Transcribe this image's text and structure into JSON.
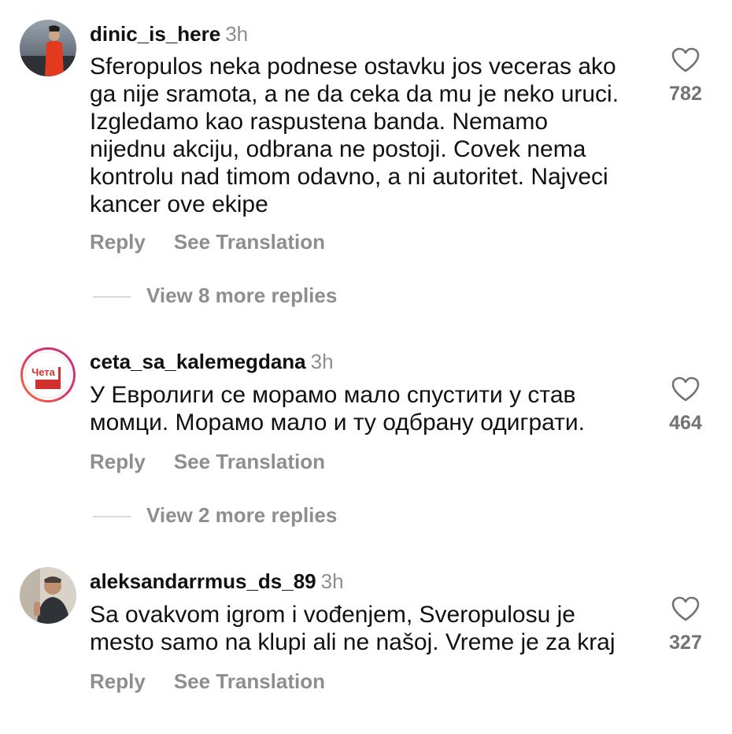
{
  "comments": [
    {
      "username": "dinic_is_here",
      "time": "3h",
      "text": "Sferopulos neka podnese ostavku jos veceras ako\nga nije sramota, a ne da ceka da mu je neko uruci.\nIzgledamo kao raspustena banda. Nemamo\nnijednu akciju, odbrana ne postoji. Covek nema\nkontrolu nad timom odavno, a ni autoritet. Najveci\nkancer ove ekipe",
      "likes": "782",
      "reply_label": "Reply",
      "translate_label": "See Translation",
      "view_replies": "View 8 more replies"
    },
    {
      "username": "ceta_sa_kalemegdana",
      "time": "3h",
      "text": "У Евролиги се морамо мало спустити у став\nмомци. Морамо мало и ту одбрану одиграти.",
      "likes": "464",
      "reply_label": "Reply",
      "translate_label": "See Translation",
      "view_replies": "View 2 more replies",
      "avatar_logo_text": "Чета"
    },
    {
      "username": "aleksandarrmus_ds_89",
      "time": "3h",
      "text": "Sa ovakvom igrom i vođenjem, Sveropulosu je\nmesto samo na klupi ali ne našoj. Vreme je za kraj",
      "likes": "327",
      "reply_label": "Reply",
      "translate_label": "See Translation"
    }
  ],
  "colors": {
    "text": "#111111",
    "secondary": "#8e8e8e",
    "like_count": "#737373",
    "story_ring_start": "#e1306c",
    "story_ring_end": "#f77737"
  }
}
